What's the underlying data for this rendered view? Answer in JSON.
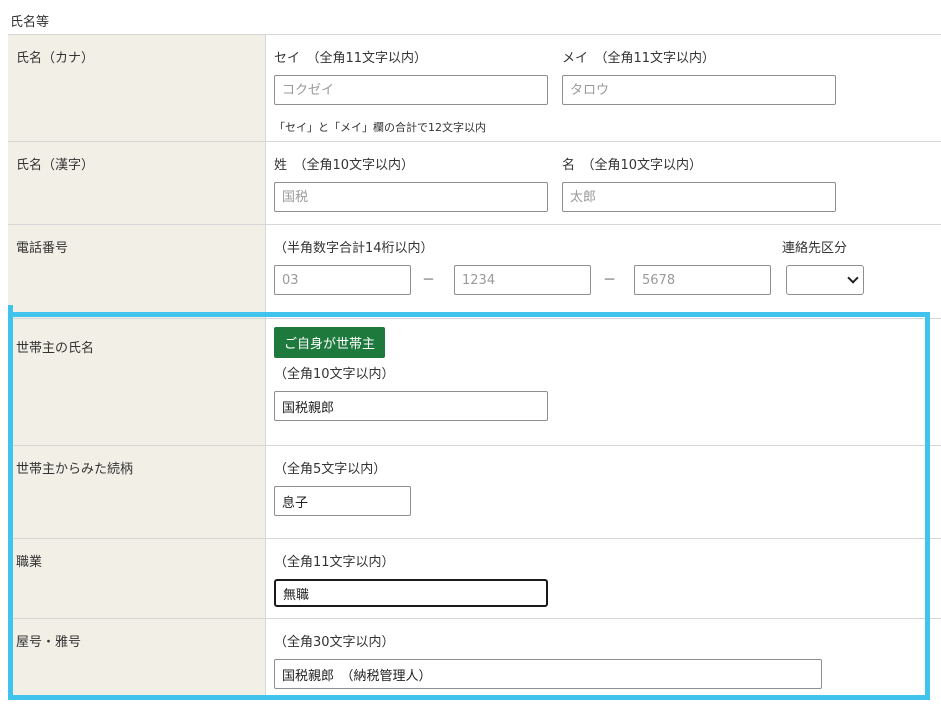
{
  "section": {
    "title": "氏名等"
  },
  "kana": {
    "label": "氏名（カナ）",
    "sei_caption": "セイ　（全角11文字以内）",
    "mei_caption": "メイ　（全角11文字以内）",
    "sei_placeholder": "コクゼイ",
    "mei_placeholder": "タロウ",
    "note": "「セイ」と「メイ」欄の合計で12文字以内"
  },
  "kanji": {
    "label": "氏名（漢字）",
    "sei_caption": "姓　（全角10文字以内）",
    "mei_caption": "名　（全角10文字以内）",
    "sei_placeholder": "国税",
    "mei_placeholder": "太郎"
  },
  "phone": {
    "label": "電話番号",
    "caption": "（半角数字合計14桁以内）",
    "contact_label": "連絡先区分",
    "part1_placeholder": "03",
    "part2_placeholder": "1234",
    "part3_placeholder": "5678",
    "separator": "－",
    "contact_value": ""
  },
  "householder": {
    "label": "世帯主の氏名",
    "button": "ご自身が世帯主",
    "caption": "（全角10文字以内）",
    "value": "国税親郎"
  },
  "relation": {
    "label": "世帯主からみた続柄",
    "caption": "（全角5文字以内）",
    "value": "息子"
  },
  "occupation": {
    "label": "職業",
    "caption": "（全角11文字以内）",
    "value": "無職"
  },
  "trade_name": {
    "label": "屋号・雅号",
    "caption": "（全角30文字以内）",
    "value": "国税親郎　（納税管理人）"
  },
  "colors": {
    "label_bg": "#f2f0e6",
    "button_bg": "#1e7a3c",
    "highlight": "#40c4ee"
  }
}
